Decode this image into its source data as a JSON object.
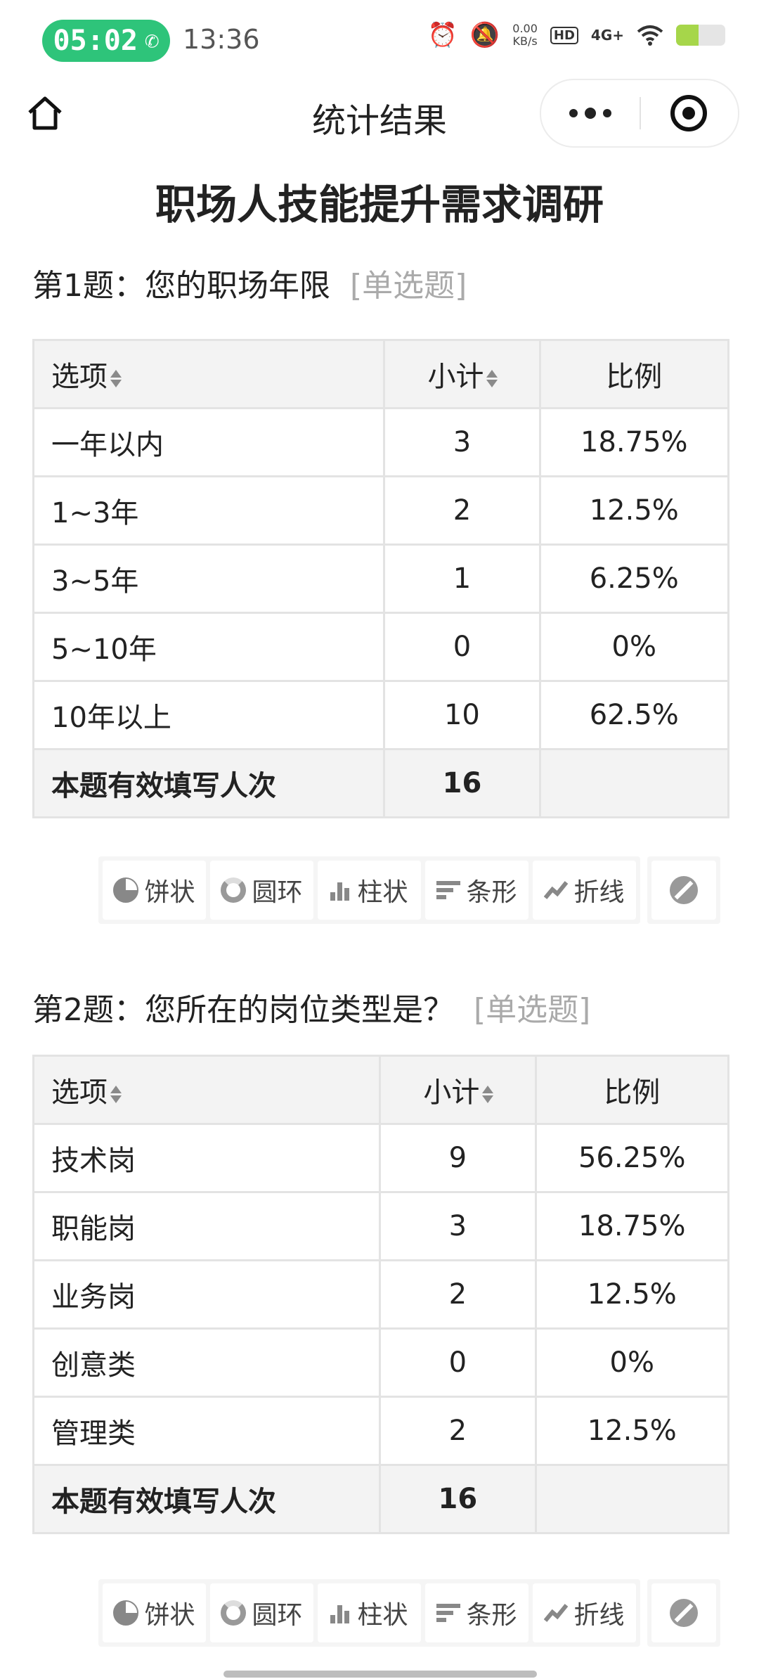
{
  "status_bar": {
    "call_timer": "05:02",
    "clock": "13:36",
    "net_speed_value": "0.00",
    "net_speed_unit": "KB/s",
    "hd_label": "HD",
    "signal_label": "4G+",
    "battery_level": 0.45,
    "icons": [
      "phone-icon",
      "alarm-icon",
      "mute-icon",
      "signal-icon",
      "wifi-icon",
      "battery-icon"
    ]
  },
  "nav": {
    "title": "统计结果",
    "icons": [
      "home-icon",
      "more-icon",
      "close-target-icon"
    ]
  },
  "survey_title": "职场人技能提升需求调研",
  "headers": {
    "option": "选项",
    "subtotal": "小计",
    "ratio": "比例"
  },
  "total_label": "本题有效填写人次",
  "chart_buttons": [
    {
      "icon": "pie-chart-icon",
      "label": "饼状"
    },
    {
      "icon": "ring-chart-icon",
      "label": "圆环"
    },
    {
      "icon": "column-chart-icon",
      "label": "柱状"
    },
    {
      "icon": "bar-chart-icon",
      "label": "条形"
    },
    {
      "icon": "line-chart-icon",
      "label": "折线"
    }
  ],
  "hide_chart_icon": "ban-icon",
  "questions": [
    {
      "number": "第1题：",
      "text": "您的职场年限",
      "type": "[单选题]",
      "rows": [
        {
          "option": "一年以内",
          "count": "3",
          "ratio": "18.75%"
        },
        {
          "option": "1~3年",
          "count": "2",
          "ratio": "12.5%"
        },
        {
          "option": "3~5年",
          "count": "1",
          "ratio": "6.25%"
        },
        {
          "option": "5~10年",
          "count": "0",
          "ratio": "0%"
        },
        {
          "option": "10年以上",
          "count": "10",
          "ratio": "62.5%"
        }
      ],
      "total": "16"
    },
    {
      "number": "第2题：",
      "text": "您所在的岗位类型是？",
      "type": "[单选题]",
      "rows": [
        {
          "option": "技术岗",
          "count": "9",
          "ratio": "56.25%"
        },
        {
          "option": "职能岗",
          "count": "3",
          "ratio": "18.75%"
        },
        {
          "option": "业务岗",
          "count": "2",
          "ratio": "12.5%"
        },
        {
          "option": "创意类",
          "count": "0",
          "ratio": "0%"
        },
        {
          "option": "管理类",
          "count": "2",
          "ratio": "12.5%"
        }
      ],
      "total": "16"
    }
  ]
}
